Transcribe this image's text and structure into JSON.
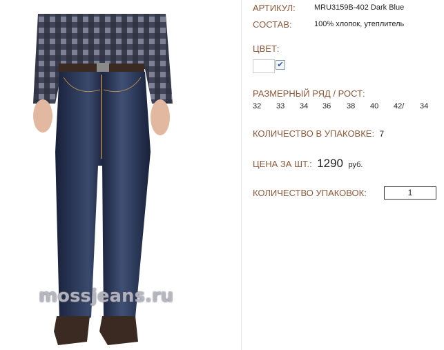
{
  "product": {
    "sku_label": "АРТИКУЛ:",
    "sku_value": "MRU3159B-402 Dark Blue",
    "composition_label": "СОСТАВ:",
    "composition_value": "100% хлопок, утеплитель",
    "color_label": "ЦВЕТ:",
    "color_checked": "✔",
    "sizes_label": "РАЗМЕРНЫЙ РЯД / РОСТ:",
    "sizes": [
      "32",
      "33",
      "34",
      "36",
      "38",
      "40",
      "42/",
      "34"
    ],
    "pack_qty_label": "КОЛИЧЕСТВО В УПАКОВКЕ:",
    "pack_qty_value": "7",
    "price_label": "ЦЕНА ЗА ШТ.:",
    "price_value": "1290",
    "price_currency": "руб.",
    "packs_label": "КОЛИЧЕСТВО УПАКОВОК:",
    "packs_value": "1"
  },
  "image": {
    "watermark": "mossjeans.ru"
  },
  "colors": {
    "label": "#8b5a3c",
    "denim": "#1f2a44"
  }
}
